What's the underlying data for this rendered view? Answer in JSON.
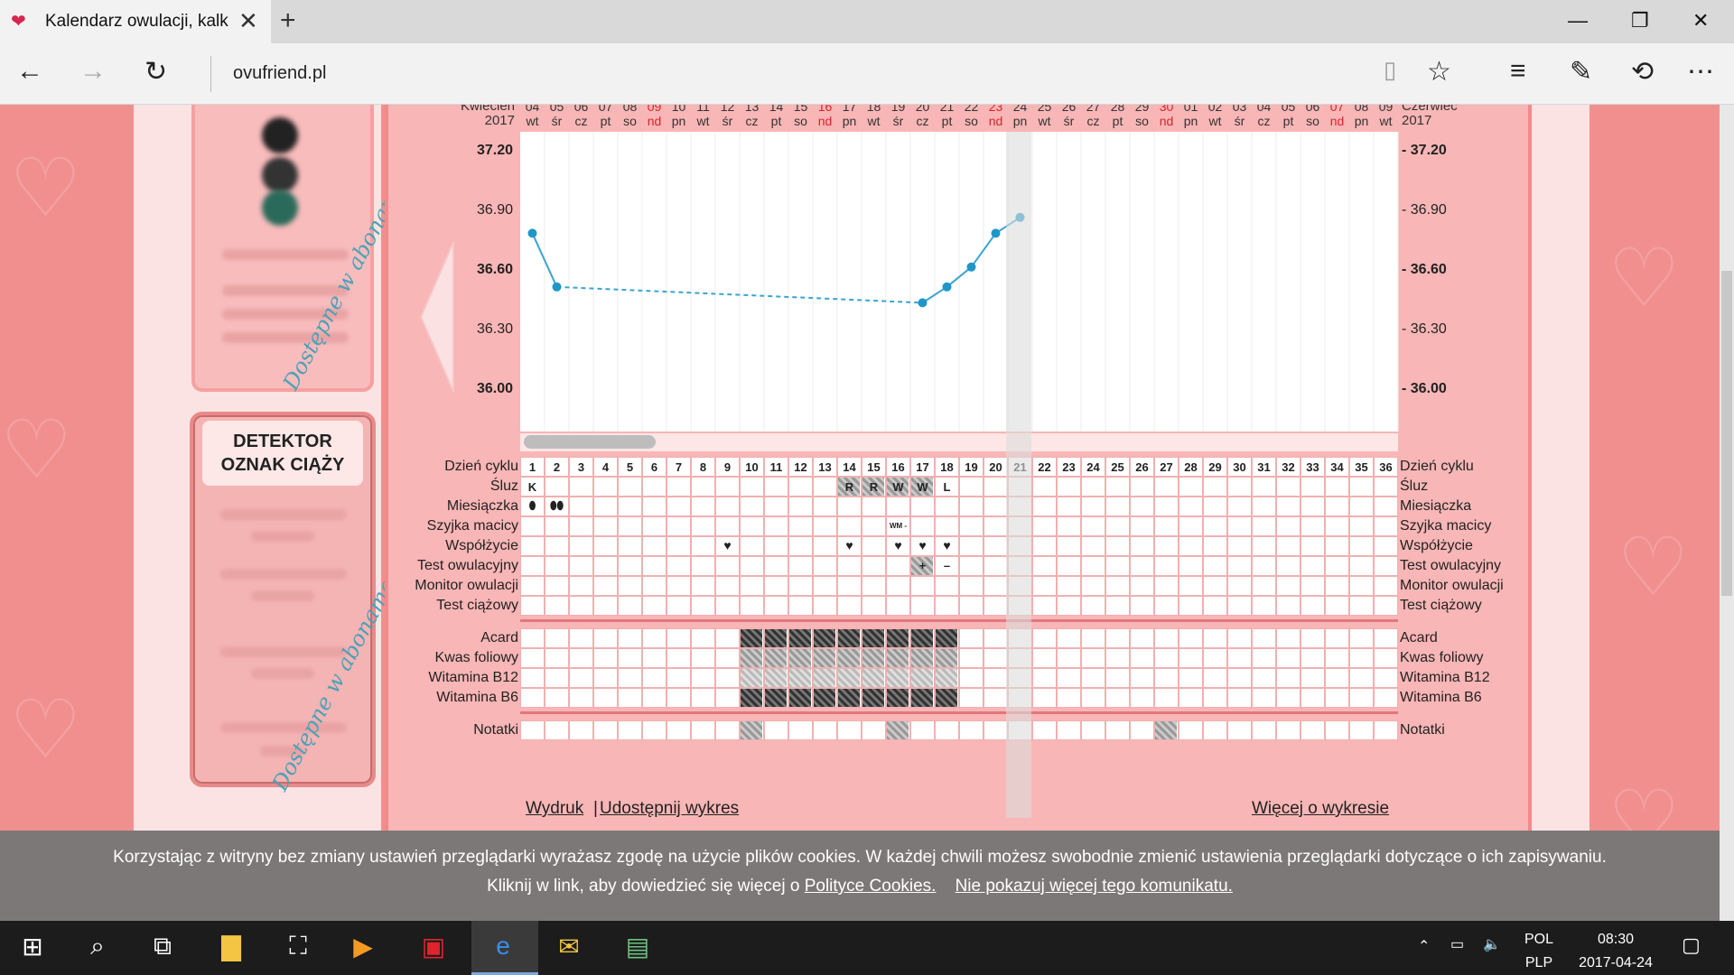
{
  "browser": {
    "tab_title": "Kalendarz owulacji, kalk",
    "url": "ovufriend.pl"
  },
  "sidebar": {
    "premium_watermark_1": "Dostępne w abonamencie Premium",
    "premium_watermark_2": "Dostępne w abonamencie Premium",
    "detector_title_1": "DETEKTOR",
    "detector_title_2": "OZNAK CIĄŻY"
  },
  "chart": {
    "month_left": "Kwiecień",
    "year_left": "2017",
    "month_right": "Czerwiec",
    "year_right": "2017",
    "y_ticks": [
      {
        "label": "37.20",
        "bold": true
      },
      {
        "label": "36.90",
        "bold": false
      },
      {
        "label": "36.60",
        "bold": true
      },
      {
        "label": "36.30",
        "bold": false
      },
      {
        "label": "36.00",
        "bold": true
      }
    ],
    "y_ticks_right": [
      "- 37.20",
      "- 36.90",
      "- 36.60",
      "- 36.30",
      "- 36.00"
    ],
    "dates": [
      {
        "d": "04",
        "w": "wt",
        "red": false
      },
      {
        "d": "05",
        "w": "śr",
        "red": false
      },
      {
        "d": "06",
        "w": "cz",
        "red": false
      },
      {
        "d": "07",
        "w": "pt",
        "red": false
      },
      {
        "d": "08",
        "w": "so",
        "red": false
      },
      {
        "d": "09",
        "w": "nd",
        "red": true
      },
      {
        "d": "10",
        "w": "pn",
        "red": false
      },
      {
        "d": "11",
        "w": "wt",
        "red": false
      },
      {
        "d": "12",
        "w": "śr",
        "red": false
      },
      {
        "d": "13",
        "w": "cz",
        "red": false
      },
      {
        "d": "14",
        "w": "pt",
        "red": false
      },
      {
        "d": "15",
        "w": "so",
        "red": false
      },
      {
        "d": "16",
        "w": "nd",
        "red": true
      },
      {
        "d": "17",
        "w": "pn",
        "red": false
      },
      {
        "d": "18",
        "w": "wt",
        "red": false
      },
      {
        "d": "19",
        "w": "śr",
        "red": false
      },
      {
        "d": "20",
        "w": "cz",
        "red": false
      },
      {
        "d": "21",
        "w": "pt",
        "red": false
      },
      {
        "d": "22",
        "w": "so",
        "red": false
      },
      {
        "d": "23",
        "w": "nd",
        "red": true
      },
      {
        "d": "24",
        "w": "pn",
        "red": false
      },
      {
        "d": "25",
        "w": "wt",
        "red": false
      },
      {
        "d": "26",
        "w": "śr",
        "red": false
      },
      {
        "d": "27",
        "w": "cz",
        "red": false
      },
      {
        "d": "28",
        "w": "pt",
        "red": false
      },
      {
        "d": "29",
        "w": "so",
        "red": false
      },
      {
        "d": "30",
        "w": "nd",
        "red": true
      },
      {
        "d": "01",
        "w": "pn",
        "red": false
      },
      {
        "d": "02",
        "w": "wt",
        "red": false
      },
      {
        "d": "03",
        "w": "śr",
        "red": false
      },
      {
        "d": "04",
        "w": "cz",
        "red": false
      },
      {
        "d": "05",
        "w": "pt",
        "red": false
      },
      {
        "d": "06",
        "w": "so",
        "red": false
      },
      {
        "d": "07",
        "w": "nd",
        "red": true
      },
      {
        "d": "08",
        "w": "pn",
        "red": false
      },
      {
        "d": "09",
        "w": "wt",
        "red": false
      }
    ],
    "rows_top": [
      "Dzień cyklu",
      "Śluz",
      "Miesiączka",
      "Szyjka macicy",
      "Współżycie",
      "Test owulacyjny",
      "Monitor owulacji",
      "Test ciążowy"
    ],
    "rows_mid": [
      "Acard",
      "Kwas foliowy",
      "Witamina B12",
      "Witamina B6"
    ],
    "rows_bottom": [
      "Notatki"
    ],
    "sluz_marks": [
      {
        "day": 1,
        "t": "K"
      },
      {
        "day": 14,
        "t": "R"
      },
      {
        "day": 15,
        "t": "R"
      },
      {
        "day": 16,
        "t": "W"
      },
      {
        "day": 17,
        "t": "W"
      },
      {
        "day": 18,
        "t": "L"
      }
    ],
    "szyjka_mark": "WM -",
    "test_marks": [
      {
        "day": 17,
        "t": "+"
      },
      {
        "day": 18,
        "t": "–"
      }
    ],
    "links": {
      "print": "Wydruk",
      "sep": "|",
      "share": "Udostępnij wykres",
      "more": "Więcej o wykresie"
    }
  },
  "chart_data": {
    "type": "line",
    "x_cycle_days": [
      1,
      2,
      17,
      18,
      19,
      20,
      21
    ],
    "y_temp": [
      36.78,
      36.51,
      36.43,
      36.51,
      36.61,
      36.78,
      36.86
    ],
    "ylim": [
      36.0,
      37.2
    ],
    "highlight_day": 21
  },
  "cookie": {
    "line1": "Korzystając z witryny bez zmiany ustawień przeglądarki wyrażasz zgodę na użycie plików cookies. W każdej chwili możesz swobodnie zmienić ustawienia przeglądarki dotyczące o ich zapisywaniu.",
    "line2_prefix": "Kliknij w link, aby dowiedzieć się więcej o",
    "policy_link": "Polityce Cookies.",
    "dismiss_link": "Nie pokazuj więcej tego komunikatu."
  },
  "taskbar": {
    "lang1": "POL",
    "lang2": "PLP",
    "time": "08:30",
    "date": "2017-04-24"
  }
}
